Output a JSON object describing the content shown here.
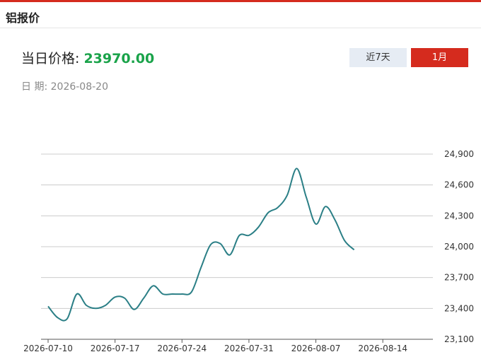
{
  "header": {
    "title": "铝报价"
  },
  "summary": {
    "price_label": "当日价格:",
    "price_value": "23970.00",
    "date_label": "日 期:",
    "date_value": "2026-08-20"
  },
  "range_buttons": [
    {
      "label": "近7天",
      "active": false
    },
    {
      "label": "1月",
      "active": true
    }
  ],
  "colors": {
    "accent": "#d52b1e",
    "price": "#1aa34a",
    "line": "#2b7f86",
    "grid": "#cccccc"
  },
  "chart_data": {
    "type": "line",
    "title": "",
    "xlabel": "",
    "ylabel": "",
    "ylim": [
      23100,
      24900
    ],
    "yticks": [
      23100,
      23400,
      23700,
      24000,
      24300,
      24600,
      24900
    ],
    "ytick_labels": [
      "23,100",
      "23,400",
      "23,700",
      "24,000",
      "24,300",
      "24,600",
      "24,900"
    ],
    "xticks": [
      "2026-07-10",
      "2026-07-17",
      "2026-07-24",
      "2026-07-31",
      "2026-08-07",
      "2026-08-14"
    ],
    "grid": true,
    "series": [
      {
        "points": [
          [
            "2026-07-10",
            23420
          ],
          [
            "2026-07-11",
            23310
          ],
          [
            "2026-07-12",
            23300
          ],
          [
            "2026-07-13",
            23540
          ],
          [
            "2026-07-14",
            23430
          ],
          [
            "2026-07-15",
            23400
          ],
          [
            "2026-07-16",
            23430
          ],
          [
            "2026-07-17",
            23510
          ],
          [
            "2026-07-18",
            23500
          ],
          [
            "2026-07-19",
            23390
          ],
          [
            "2026-07-20",
            23500
          ],
          [
            "2026-07-21",
            23620
          ],
          [
            "2026-07-22",
            23540
          ],
          [
            "2026-07-23",
            23540
          ],
          [
            "2026-07-24",
            23540
          ],
          [
            "2026-07-25",
            23560
          ],
          [
            "2026-07-26",
            23800
          ],
          [
            "2026-07-27",
            24020
          ],
          [
            "2026-07-28",
            24030
          ],
          [
            "2026-07-29",
            23920
          ],
          [
            "2026-07-30",
            24110
          ],
          [
            "2026-07-31",
            24110
          ],
          [
            "2026-08-01",
            24190
          ],
          [
            "2026-08-02",
            24330
          ],
          [
            "2026-08-03",
            24380
          ],
          [
            "2026-08-04",
            24500
          ],
          [
            "2026-08-05",
            24760
          ],
          [
            "2026-08-06",
            24480
          ],
          [
            "2026-08-07",
            24220
          ],
          [
            "2026-08-08",
            24390
          ],
          [
            "2026-08-09",
            24260
          ],
          [
            "2026-08-10",
            24060
          ],
          [
            "2026-08-11",
            23970
          ]
        ]
      }
    ]
  }
}
